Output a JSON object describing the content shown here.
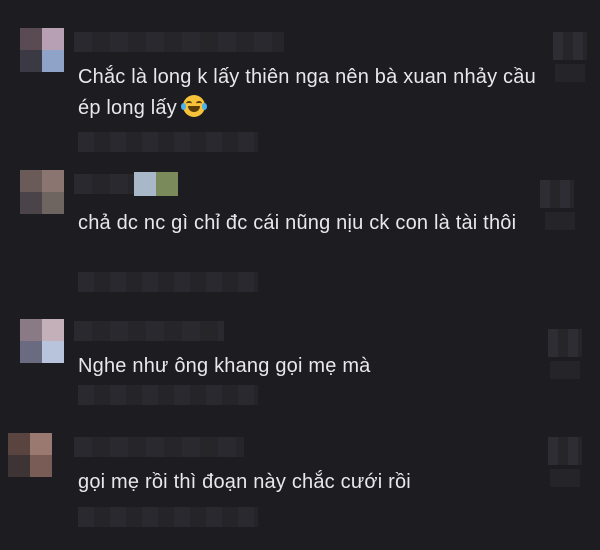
{
  "comments": [
    {
      "text": "Chắc là long k lấy thiên nga nên bà xuan nhảy cầu ép long lấy",
      "emoji": "laughing-tears-emoji"
    },
    {
      "text": "chả dc nc gì chỉ đc cái nũng nịu ck con là tài thôi"
    },
    {
      "text": "Nghe như ông khang gọi mẹ mà"
    },
    {
      "text": "gọi mẹ rồi thì đoạn này chắc cưới rồi"
    }
  ],
  "colors": {
    "background": "#1d1c21",
    "text": "#e8e8ea"
  }
}
